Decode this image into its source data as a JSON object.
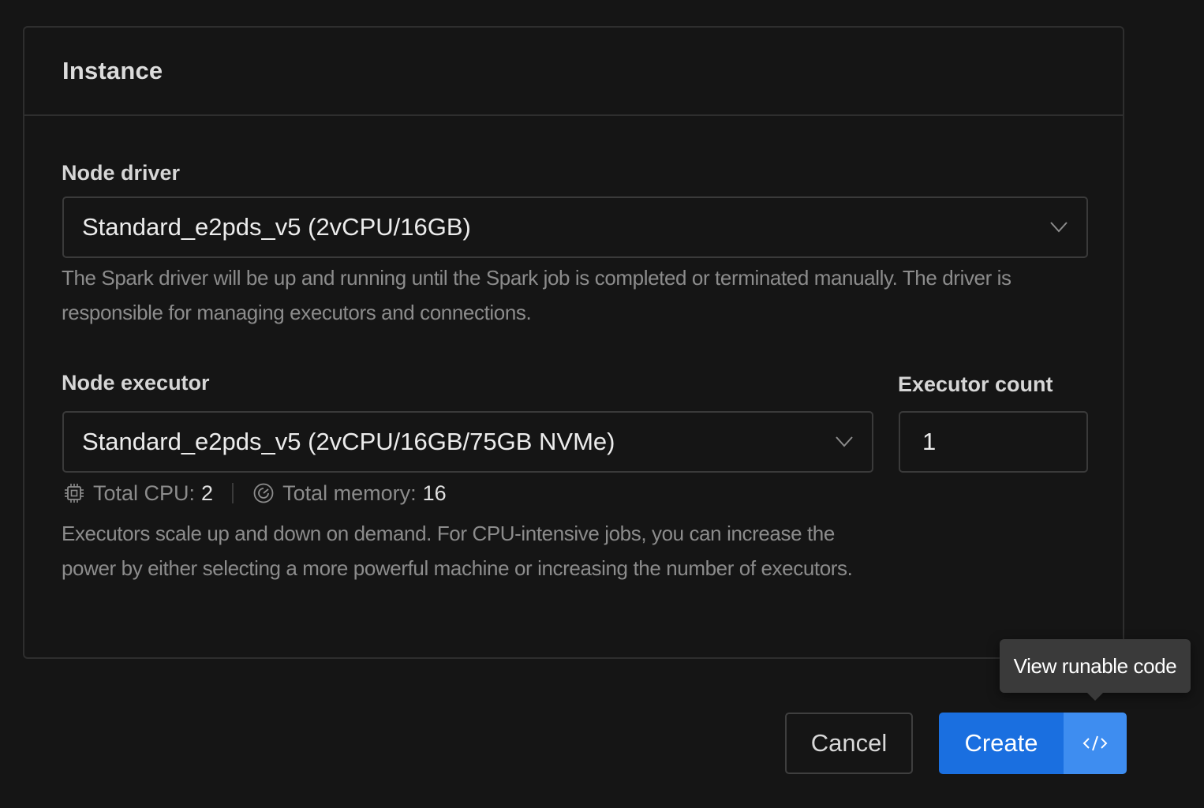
{
  "card": {
    "title": "Instance"
  },
  "driver": {
    "label": "Node driver",
    "value": "Standard_e2pds_v5 (2vCPU/16GB)",
    "help": "The Spark driver will be up and running until the Spark job is completed or terminated manually. The driver is responsible for managing executors and connections."
  },
  "executor": {
    "label": "Node executor",
    "value": "Standard_e2pds_v5 (2vCPU/16GB/75GB NVMe)",
    "help": "Executors scale up and down on demand. For CPU-intensive jobs, you can increase the power by either selecting a more powerful machine or increasing the number of executors."
  },
  "executor_count": {
    "label": "Executor count",
    "value": "1"
  },
  "stats": {
    "cpu_label": "Total CPU:",
    "cpu_value": "2",
    "cpu_icon": "cpu-chip-icon",
    "memory_label": "Total memory:",
    "memory_value": "16",
    "memory_icon": "memory-gauge-icon"
  },
  "actions": {
    "cancel_label": "Cancel",
    "create_label": "Create",
    "code_icon": "code-icon",
    "tooltip": "View runable code"
  },
  "colors": {
    "background": "#151515",
    "primary": "#1a6fe0",
    "primary_light": "#3e8df0",
    "tooltip_bg": "#3a3a3a"
  }
}
